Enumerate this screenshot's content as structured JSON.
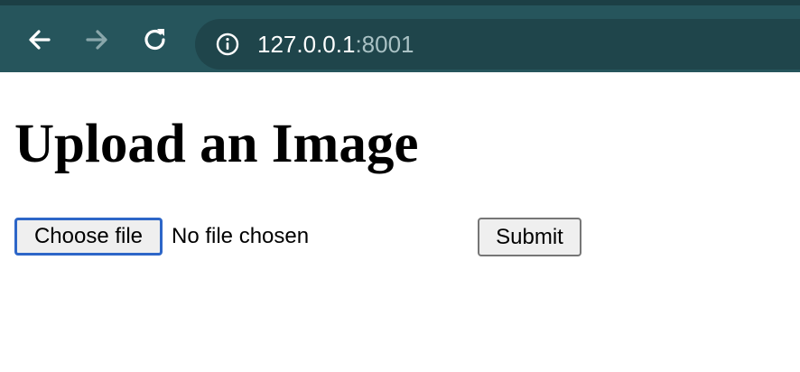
{
  "browser": {
    "back_icon": "arrow-left-icon",
    "forward_icon": "arrow-right-icon",
    "reload_icon": "reload-icon",
    "site_info_icon": "info-circle-icon",
    "url_host": "127.0.0.1",
    "url_port": ":8001",
    "colors": {
      "toolbar": "#26555c",
      "omnibox": "#1f454b",
      "url_text": "#ffffff",
      "url_port_text": "#a9c1c4"
    }
  },
  "page": {
    "heading": "Upload an Image",
    "file_input": {
      "button_label": "Choose file",
      "status": "No file chosen"
    },
    "submit_label": "Submit",
    "colors": {
      "focus_ring": "#2d66c8",
      "button_bg": "#efefef"
    }
  }
}
